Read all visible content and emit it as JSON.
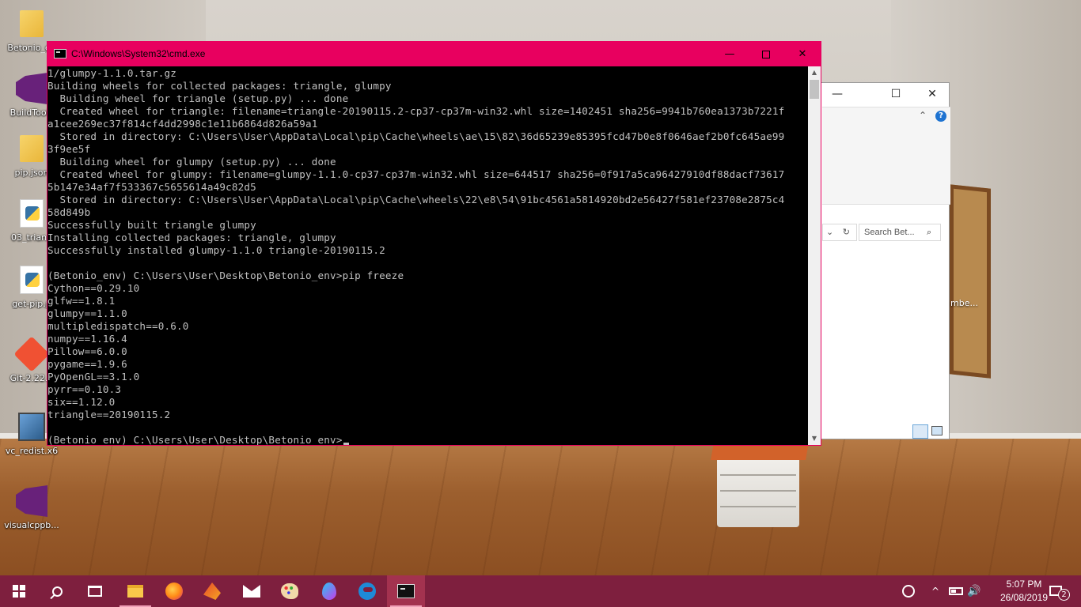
{
  "desktop": {
    "icons": [
      {
        "label": "Betonio_en",
        "icon": "folder-icon"
      },
      {
        "label": "BuildTools",
        "icon": "visual-studio-icon"
      },
      {
        "label": "pip.json",
        "icon": "folder-icon"
      },
      {
        "label": "03_triang",
        "icon": "python-file-icon"
      },
      {
        "label": "get-pip.p",
        "icon": "python-file-icon"
      },
      {
        "label": "Git-2.22.0",
        "icon": "git-installer-icon"
      },
      {
        "label": "vc_redist.x6",
        "icon": "setup-icon"
      },
      {
        "label": "visualcppb...",
        "icon": "visual-studio-icon"
      }
    ]
  },
  "explorer": {
    "search_placeholder": "Search Bet...",
    "help_glyph": "?",
    "refresh_glyph": "↻",
    "chevron_glyph": "⌃",
    "behind_label": "mbe..."
  },
  "cmd": {
    "title": "C:\\Windows\\System32\\cmd.exe",
    "buttons": {
      "minimize": "—",
      "close": "✕"
    },
    "lines": [
      "1/glumpy-1.1.0.tar.gz",
      "Building wheels for collected packages: triangle, glumpy",
      "  Building wheel for triangle (setup.py) ... done",
      "  Created wheel for triangle: filename=triangle-20190115.2-cp37-cp37m-win32.whl size=1402451 sha256=9941b760ea1373b7221f",
      "a1cee269ec37f814cf4dd2998c1e11b6864d826a59a1",
      "  Stored in directory: C:\\Users\\User\\AppData\\Local\\pip\\Cache\\wheels\\ae\\15\\82\\36d65239e85395fcd47b0e8f0646aef2b0fc645ae99",
      "3f9ee5f",
      "  Building wheel for glumpy (setup.py) ... done",
      "  Created wheel for glumpy: filename=glumpy-1.1.0-cp37-cp37m-win32.whl size=644517 sha256=0f917a5ca96427910df88dacf73617",
      "5b147e34af7f533367c5655614a49c82d5",
      "  Stored in directory: C:\\Users\\User\\AppData\\Local\\pip\\Cache\\wheels\\22\\e8\\54\\91bc4561a5814920bd2e56427f581ef23708e2875c4",
      "58d849b",
      "Successfully built triangle glumpy",
      "Installing collected packages: triangle, glumpy",
      "Successfully installed glumpy-1.1.0 triangle-20190115.2",
      "",
      "(Betonio_env) C:\\Users\\User\\Desktop\\Betonio_env>pip freeze",
      "Cython==0.29.10",
      "glfw==1.8.1",
      "glumpy==1.1.0",
      "multipledispatch==0.6.0",
      "numpy==1.16.4",
      "Pillow==6.0.0",
      "pygame==1.9.6",
      "PyOpenGL==3.1.0",
      "pyrr==0.10.3",
      "six==1.12.0",
      "triangle==20190115.2",
      "",
      "(Betonio_env) C:\\Users\\User\\Desktop\\Betonio_env>"
    ],
    "scroll_up": "▲",
    "scroll_down": "▼"
  },
  "taskbar": {
    "apps": [
      {
        "name": "file-explorer",
        "icon": "folder-icon"
      },
      {
        "name": "firefox",
        "icon": "firefox-icon"
      },
      {
        "name": "tool-app",
        "icon": "tool-icon"
      },
      {
        "name": "mail",
        "icon": "mail-icon"
      },
      {
        "name": "paint",
        "icon": "paint-icon"
      },
      {
        "name": "paint-3d",
        "icon": "balloon-icon"
      },
      {
        "name": "edge",
        "icon": "edge-icon"
      },
      {
        "name": "command-prompt",
        "icon": "cmd-icon"
      }
    ],
    "tray": {
      "time": "5:07 PM",
      "date": "26/08/2019",
      "notification_count": "2",
      "chevron_glyph": "^",
      "speaker_glyph": "🔊"
    }
  }
}
